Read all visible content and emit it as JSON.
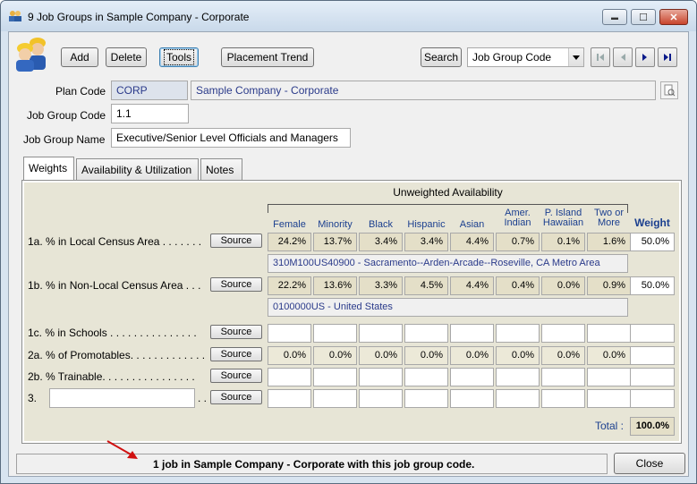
{
  "window": {
    "title": "9 Job Groups in Sample Company - Corporate",
    "minimize_glyph": "▬",
    "maximize_glyph": "☐",
    "close_glyph": "✕"
  },
  "toolbar": {
    "add_label": "Add",
    "delete_label": "Delete",
    "tools_label": "Tools",
    "placement_trend_label": "Placement Trend",
    "search_label": "Search",
    "search_field_value": "Job Group Code"
  },
  "form": {
    "plan_code_label": "Plan Code",
    "plan_code_value": "CORP",
    "plan_name_value": "Sample Company - Corporate",
    "job_group_code_label": "Job Group Code",
    "job_group_code_value": "1.1",
    "job_group_name_label": "Job Group Name",
    "job_group_name_value": "Executive/Senior Level Officials and Managers"
  },
  "tabs": [
    "Weights",
    "Availability & Utilization",
    "Notes"
  ],
  "weights": {
    "group_header": "Unweighted Availability",
    "columns": [
      "Female",
      "Minority",
      "Black",
      "Hispanic",
      "Asian",
      "Amer.\nIndian",
      "P. Island\nHawaiian",
      "Two or\nMore"
    ],
    "weight_header": "Weight",
    "source_label": "Source",
    "rows": [
      {
        "label": "1a.  % in Local Census Area . . . . . . .",
        "values": [
          "24.2%",
          "13.7%",
          "3.4%",
          "3.4%",
          "4.4%",
          "0.7%",
          "0.1%",
          "1.6%"
        ],
        "weight": "50.0%",
        "area": "310M100US40900 - Sacramento--Arden-Arcade--Roseville, CA Metro Area"
      },
      {
        "label": "1b.  % in Non-Local Census Area . . .",
        "values": [
          "22.2%",
          "13.6%",
          "3.3%",
          "4.5%",
          "4.4%",
          "0.4%",
          "0.0%",
          "0.9%"
        ],
        "weight": "50.0%",
        "area": "0100000US - United States"
      },
      {
        "label": "1c.  % in Schools . . . . . . . . . . . . . . .",
        "values": [
          "",
          "",
          "",
          "",
          "",
          "",
          "",
          ""
        ],
        "weight": ""
      },
      {
        "label": "2a.  % of Promotables. . . . . . . . . . . . .",
        "values": [
          "0.0%",
          "0.0%",
          "0.0%",
          "0.0%",
          "0.0%",
          "0.0%",
          "0.0%",
          "0.0%"
        ],
        "weight": ""
      },
      {
        "label": "2b.  % Trainable. . . . . . . . . . . . . . . .",
        "values": [
          "",
          "",
          "",
          "",
          "",
          "",
          "",
          ""
        ],
        "weight": ""
      },
      {
        "label": "3.",
        "values": [
          "",
          "",
          "",
          "",
          "",
          "",
          "",
          ""
        ],
        "weight": "",
        "custom_text": "",
        "trail": ". . ."
      }
    ],
    "total_label": "Total :",
    "total_value": "100.0%"
  },
  "status": {
    "message": "1 job in Sample Company - Corporate with this job group code.",
    "close_label": "Close"
  }
}
